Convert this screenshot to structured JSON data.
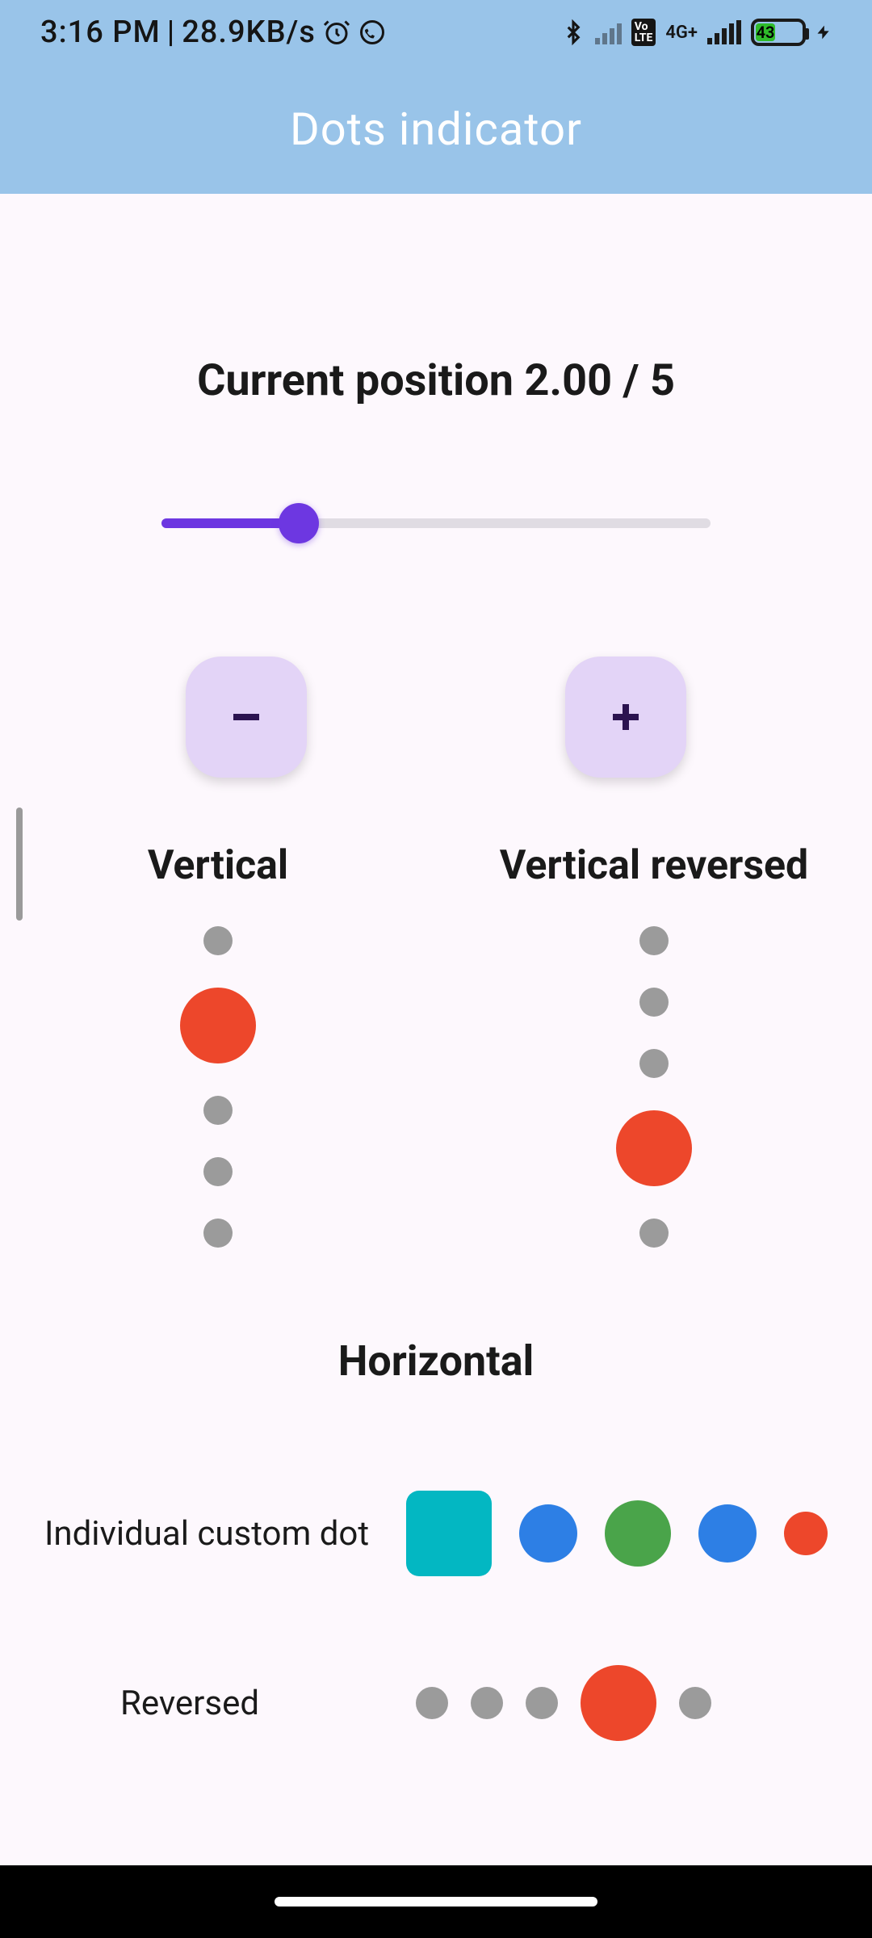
{
  "status": {
    "time": "3:16 PM",
    "separator": " | ",
    "net_speed": "28.9KB/s",
    "battery_pct": 43,
    "battery_label": "43",
    "network_label": "4G+",
    "icons": [
      "alarm",
      "whatsapp",
      "bluetooth",
      "signal-disabled",
      "volte",
      "signal",
      "battery",
      "charging"
    ]
  },
  "appbar": {
    "title": "Dots indicator"
  },
  "position": {
    "prefix": "Current position ",
    "value": "2.00",
    "sep": " / ",
    "total": "5"
  },
  "slider": {
    "min": 1,
    "max": 5,
    "value": 2,
    "percent": 25
  },
  "buttons": {
    "minus_label": "−",
    "plus_label": "+"
  },
  "sections": {
    "vertical": {
      "title": "Vertical",
      "count": 5,
      "active_index": 1
    },
    "vertical_reversed": {
      "title": "Vertical reversed",
      "count": 5,
      "active_index": 3
    },
    "horizontal_heading": "Horizontal",
    "individual": {
      "label": "Individual custom dot",
      "dots": [
        {
          "shape": "rounded-square",
          "color": "#03b7c2",
          "size": 106,
          "active": true
        },
        {
          "shape": "circle",
          "color": "#2d7fe5",
          "size": 72
        },
        {
          "shape": "circle",
          "color": "#4aa44a",
          "size": 82
        },
        {
          "shape": "circle",
          "color": "#2d7fe5",
          "size": 72
        },
        {
          "shape": "circle",
          "color": "#ed472b",
          "size": 54
        }
      ]
    },
    "reversed": {
      "label": "Reversed",
      "count": 5,
      "active_index": 3
    }
  },
  "colors": {
    "appbar_bg": "#99c4e9",
    "accent": "#6d37e1",
    "fab_bg": "#e3d4f7",
    "dot_inactive": "#9b9b9b",
    "dot_active_red": "#ed472b"
  }
}
